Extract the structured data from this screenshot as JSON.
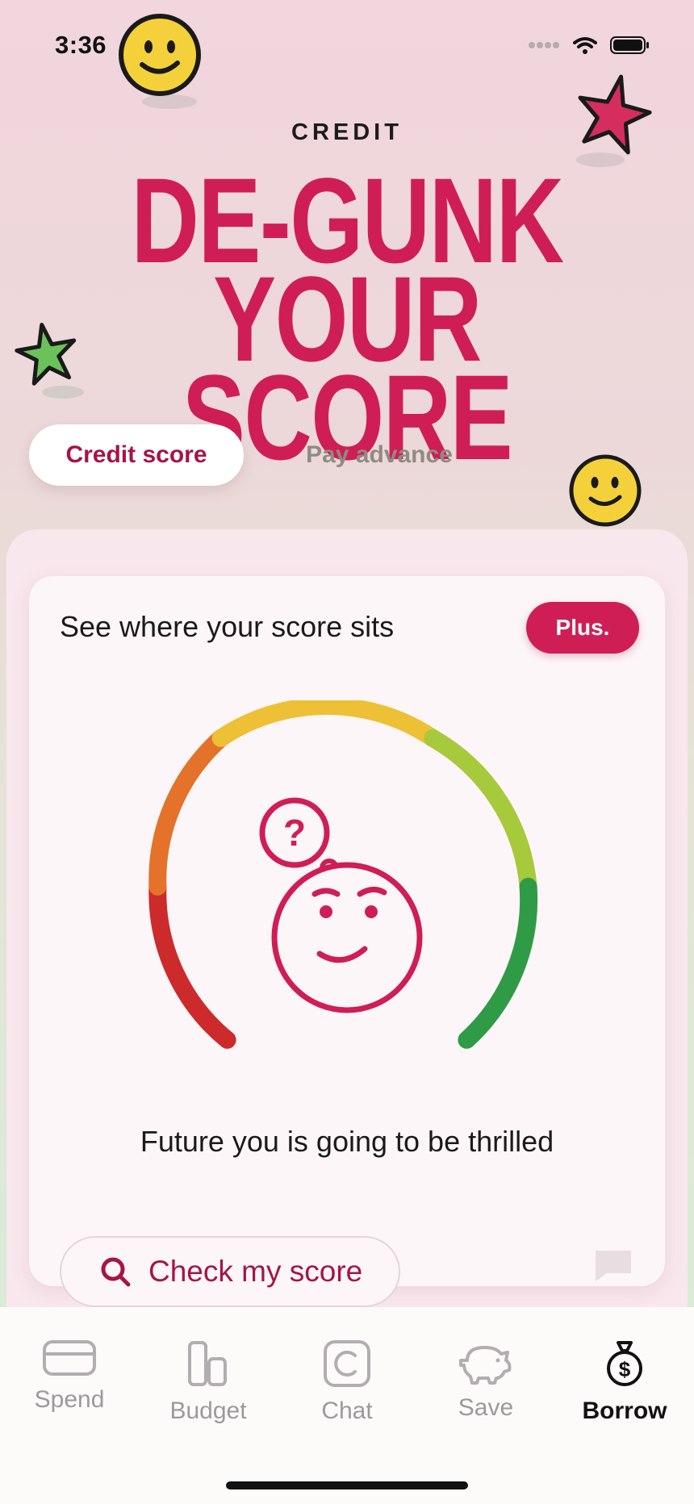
{
  "status_bar": {
    "time": "3:36"
  },
  "header": {
    "eyebrow": "CREDIT",
    "headline_line1": "DE-GUNK",
    "headline_line2": "YOUR SCORE"
  },
  "tabs": [
    {
      "label": "Credit score",
      "active": true
    },
    {
      "label": "Pay advance",
      "active": false
    }
  ],
  "score_card": {
    "title": "See where your score sits",
    "badge": "Plus.",
    "message": "Future you is going to be thrilled",
    "cta_label": "Check my score"
  },
  "nav": {
    "items": [
      {
        "label": "Spend",
        "icon": "card-icon"
      },
      {
        "label": "Budget",
        "icon": "bar-chart-icon"
      },
      {
        "label": "Chat",
        "icon": "chat-c-icon"
      },
      {
        "label": "Save",
        "icon": "piggy-bank-icon"
      },
      {
        "label": "Borrow",
        "icon": "money-bag-icon"
      }
    ],
    "active": "Borrow"
  },
  "colors": {
    "brand": "#cf1e55",
    "brand_dark": "#a51545",
    "gauge": [
      "#cd2a2c",
      "#e4722a",
      "#eec035",
      "#a7c93c",
      "#2f9b47"
    ]
  }
}
